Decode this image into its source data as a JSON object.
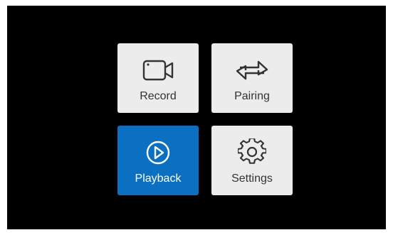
{
  "menu": {
    "tiles": [
      {
        "label": "Record",
        "icon": "video-camera-icon",
        "selected": false
      },
      {
        "label": "Pairing",
        "icon": "swap-arrows-icon",
        "selected": false
      },
      {
        "label": "Playback",
        "icon": "play-circle-icon",
        "selected": true
      },
      {
        "label": "Settings",
        "icon": "gear-icon",
        "selected": false
      }
    ]
  },
  "colors": {
    "background": "#000000",
    "tile": "#ececec",
    "selected_tile": "#0b6fc2",
    "label": "#333333",
    "selected_label": "#ffffff"
  }
}
